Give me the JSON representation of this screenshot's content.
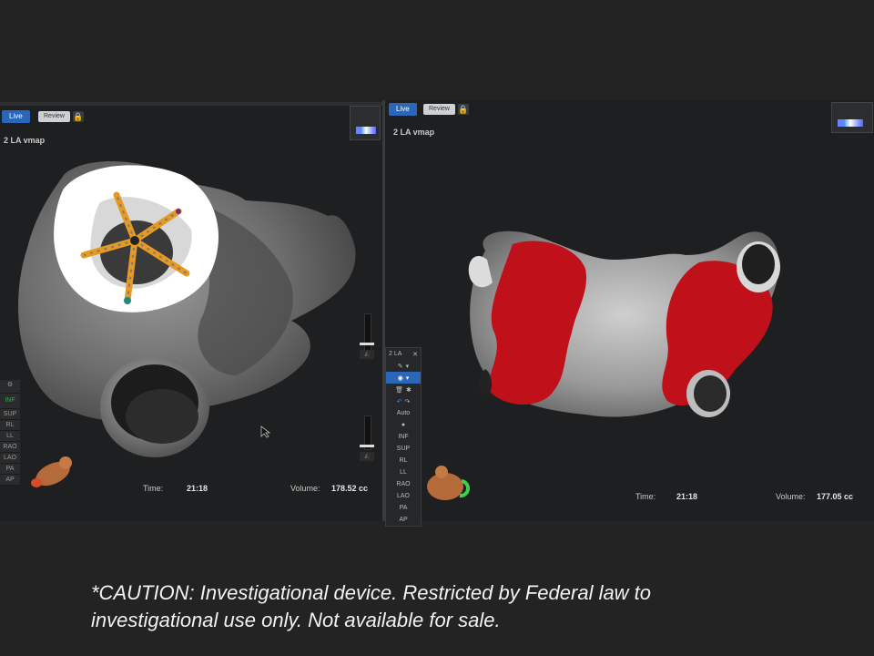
{
  "left_view": {
    "tabs": {
      "live": "Live",
      "review": "Review"
    },
    "map_name": "2 LA vmap",
    "time_label": "Time:",
    "time_value": "21:18",
    "volume_label": "Volume:",
    "volume_value": "178.52 cc",
    "view_buttons": [
      "SUP",
      "RL",
      "LL",
      "RAO",
      "LAO",
      "PA",
      "AP"
    ],
    "partial_label": "INF"
  },
  "right_view": {
    "tabs": {
      "live": "Live",
      "review": "Review"
    },
    "map_name": "2 LA vmap",
    "time_label": "Time:",
    "time_value": "21:18",
    "volume_label": "Volume:",
    "volume_value": "177.05 cc",
    "toolbox": {
      "title": "2 LA",
      "auto_label": "Auto",
      "view_buttons": [
        "INF",
        "SUP",
        "RL",
        "LL",
        "RAO",
        "LAO",
        "PA",
        "AP"
      ]
    }
  },
  "icons": [
    "lock-icon",
    "color-legend-icon",
    "cursor-icon",
    "torso-orientation-icon",
    "undo-icon",
    "redo-icon",
    "trash-icon",
    "settings-icon"
  ],
  "colors": {
    "live_blue": "#2a67b8",
    "lesion_red": "#c0101a",
    "catheter_orange": "#e79a22"
  },
  "caption": {
    "line1": "*CAUTION: Investigational device. Restricted by Federal law to",
    "line2": "investigational use only. Not available for sale."
  }
}
